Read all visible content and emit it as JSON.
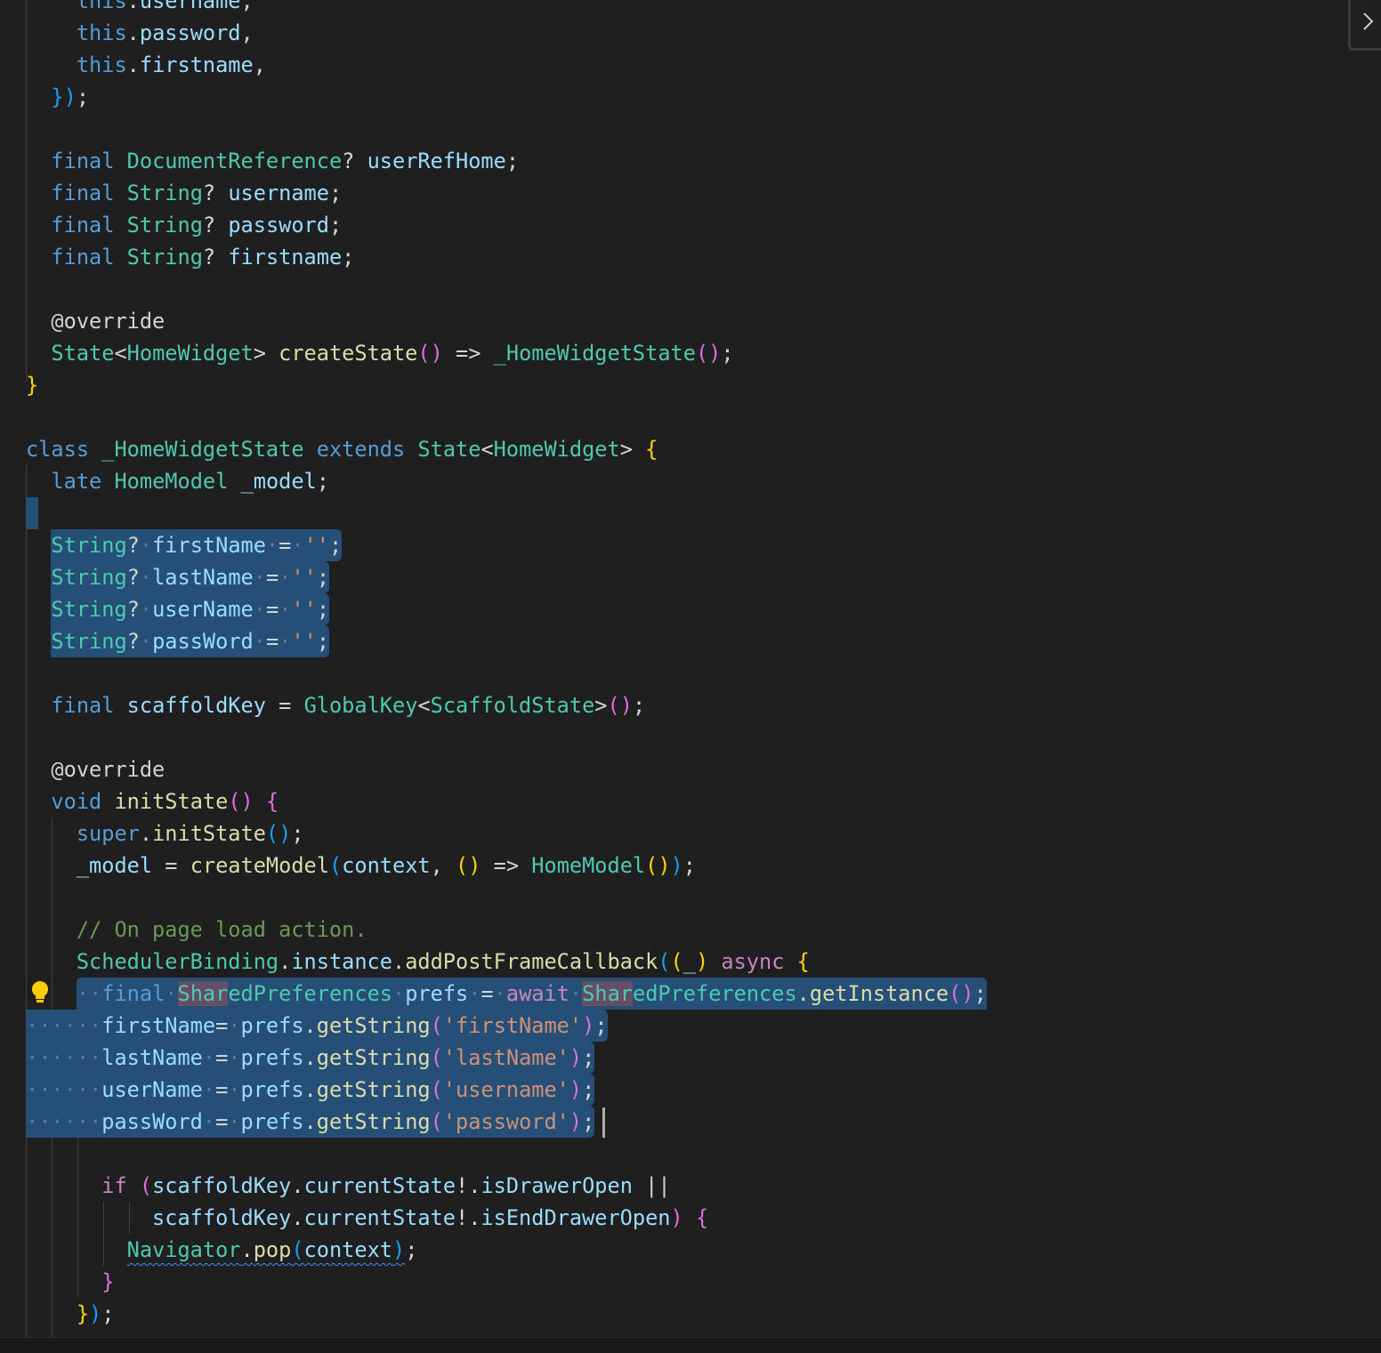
{
  "editor": {
    "language": "dart",
    "lines": [
      {
        "indent": 4,
        "t": [
          [
            "kw",
            "this"
          ],
          [
            "p",
            "."
          ],
          [
            "v",
            "username"
          ],
          [
            "p",
            ","
          ]
        ]
      },
      {
        "indent": 4,
        "t": [
          [
            "kw",
            "this"
          ],
          [
            "p",
            "."
          ],
          [
            "v",
            "password"
          ],
          [
            "p",
            ","
          ]
        ]
      },
      {
        "indent": 4,
        "t": [
          [
            "kw",
            "this"
          ],
          [
            "p",
            "."
          ],
          [
            "v",
            "firstname"
          ],
          [
            "p",
            ","
          ]
        ]
      },
      {
        "indent": 2,
        "t": [
          [
            "b3",
            "}"
          ],
          [
            "b3",
            ")"
          ],
          [
            "p",
            ";"
          ]
        ]
      },
      {
        "indent": 0,
        "t": []
      },
      {
        "indent": 2,
        "t": [
          [
            "kw",
            "final"
          ],
          [
            "p",
            " "
          ],
          [
            "ty",
            "DocumentReference"
          ],
          [
            "p",
            "? "
          ],
          [
            "v",
            "userRefHome"
          ],
          [
            "p",
            ";"
          ]
        ]
      },
      {
        "indent": 2,
        "t": [
          [
            "kw",
            "final"
          ],
          [
            "p",
            " "
          ],
          [
            "ty",
            "String"
          ],
          [
            "p",
            "? "
          ],
          [
            "v",
            "username"
          ],
          [
            "p",
            ";"
          ]
        ]
      },
      {
        "indent": 2,
        "t": [
          [
            "kw",
            "final"
          ],
          [
            "p",
            " "
          ],
          [
            "ty",
            "String"
          ],
          [
            "p",
            "? "
          ],
          [
            "v",
            "password"
          ],
          [
            "p",
            ";"
          ]
        ]
      },
      {
        "indent": 2,
        "t": [
          [
            "kw",
            "final"
          ],
          [
            "p",
            " "
          ],
          [
            "ty",
            "String"
          ],
          [
            "p",
            "? "
          ],
          [
            "v",
            "firstname"
          ],
          [
            "p",
            ";"
          ]
        ]
      },
      {
        "indent": 0,
        "t": []
      },
      {
        "indent": 2,
        "t": [
          [
            "an",
            "@override"
          ]
        ]
      },
      {
        "indent": 2,
        "t": [
          [
            "ty",
            "State"
          ],
          [
            "p",
            "<"
          ],
          [
            "ty",
            "HomeWidget"
          ],
          [
            "p",
            "> "
          ],
          [
            "fn",
            "createState"
          ],
          [
            "b2",
            "()"
          ],
          [
            "p",
            " => "
          ],
          [
            "ty",
            "_HomeWidgetState"
          ],
          [
            "b2",
            "()"
          ],
          [
            "p",
            ";"
          ]
        ]
      },
      {
        "indent": 0,
        "t": [
          [
            "b1",
            "}"
          ]
        ]
      },
      {
        "indent": 0,
        "t": []
      },
      {
        "indent": 0,
        "t": [
          [
            "kw",
            "class"
          ],
          [
            "p",
            " "
          ],
          [
            "ty",
            "_HomeWidgetState"
          ],
          [
            "p",
            " "
          ],
          [
            "kw",
            "extends"
          ],
          [
            "p",
            " "
          ],
          [
            "ty",
            "State"
          ],
          [
            "p",
            "<"
          ],
          [
            "ty",
            "HomeWidget"
          ],
          [
            "p",
            "> "
          ],
          [
            "b1",
            "{"
          ]
        ]
      },
      {
        "indent": 2,
        "t": [
          [
            "kw",
            "late"
          ],
          [
            "p",
            " "
          ],
          [
            "ty",
            "HomeModel"
          ],
          [
            "p",
            " "
          ],
          [
            "v",
            "_model"
          ],
          [
            "p",
            ";"
          ]
        ]
      },
      {
        "indent": 0,
        "t": [],
        "selected": "empty"
      },
      {
        "indent": 2,
        "t": [
          [
            "ty",
            "String"
          ],
          [
            "p",
            "?"
          ],
          [
            "ws",
            "·"
          ],
          [
            "v",
            "firstName"
          ],
          [
            "ws",
            "·"
          ],
          [
            "p",
            "="
          ],
          [
            "ws",
            "·"
          ],
          [
            "s",
            "''"
          ],
          [
            "p",
            ";"
          ]
        ],
        "selected": "full"
      },
      {
        "indent": 2,
        "t": [
          [
            "ty",
            "String"
          ],
          [
            "p",
            "?"
          ],
          [
            "ws",
            "·"
          ],
          [
            "v",
            "lastName"
          ],
          [
            "ws",
            "·"
          ],
          [
            "p",
            "="
          ],
          [
            "ws",
            "·"
          ],
          [
            "s",
            "''"
          ],
          [
            "p",
            ";"
          ]
        ],
        "selected": "full"
      },
      {
        "indent": 2,
        "t": [
          [
            "ty",
            "String"
          ],
          [
            "p",
            "?"
          ],
          [
            "ws",
            "·"
          ],
          [
            "v",
            "userName"
          ],
          [
            "ws",
            "·"
          ],
          [
            "p",
            "="
          ],
          [
            "ws",
            "·"
          ],
          [
            "s",
            "''"
          ],
          [
            "p",
            ";"
          ]
        ],
        "selected": "full"
      },
      {
        "indent": 2,
        "t": [
          [
            "ty",
            "String"
          ],
          [
            "p",
            "?"
          ],
          [
            "ws",
            "·"
          ],
          [
            "v",
            "passWord"
          ],
          [
            "ws",
            "·"
          ],
          [
            "p",
            "="
          ],
          [
            "ws",
            "·"
          ],
          [
            "s",
            "''"
          ],
          [
            "p",
            ";"
          ]
        ],
        "selected": "full"
      },
      {
        "indent": 0,
        "t": []
      },
      {
        "indent": 2,
        "t": [
          [
            "kw",
            "final"
          ],
          [
            "p",
            " "
          ],
          [
            "v",
            "scaffoldKey"
          ],
          [
            "p",
            " = "
          ],
          [
            "ty",
            "GlobalKey"
          ],
          [
            "p",
            "<"
          ],
          [
            "ty",
            "ScaffoldState"
          ],
          [
            "p",
            ">"
          ],
          [
            "b2",
            "()"
          ],
          [
            "p",
            ";"
          ]
        ]
      },
      {
        "indent": 0,
        "t": []
      },
      {
        "indent": 2,
        "t": [
          [
            "an",
            "@override"
          ]
        ]
      },
      {
        "indent": 2,
        "t": [
          [
            "kw",
            "void"
          ],
          [
            "p",
            " "
          ],
          [
            "fn",
            "initState"
          ],
          [
            "b2",
            "()"
          ],
          [
            "p",
            " "
          ],
          [
            "b2",
            "{"
          ]
        ]
      },
      {
        "indent": 4,
        "t": [
          [
            "kw",
            "super"
          ],
          [
            "p",
            "."
          ],
          [
            "fn",
            "initState"
          ],
          [
            "b3",
            "()"
          ],
          [
            "p",
            ";"
          ]
        ]
      },
      {
        "indent": 4,
        "t": [
          [
            "v",
            "_model"
          ],
          [
            "p",
            " = "
          ],
          [
            "fn",
            "createModel"
          ],
          [
            "b3",
            "("
          ],
          [
            "v",
            "context"
          ],
          [
            "p",
            ", "
          ],
          [
            "b1",
            "()"
          ],
          [
            "p",
            " => "
          ],
          [
            "ty",
            "HomeModel"
          ],
          [
            "b1",
            "()"
          ],
          [
            "b3",
            ")"
          ],
          [
            "p",
            ";"
          ]
        ]
      },
      {
        "indent": 0,
        "t": []
      },
      {
        "indent": 4,
        "t": [
          [
            "c",
            "// On page load action."
          ]
        ]
      },
      {
        "indent": 4,
        "t": [
          [
            "ty",
            "SchedulerBinding"
          ],
          [
            "p",
            "."
          ],
          [
            "v",
            "instance"
          ],
          [
            "p",
            "."
          ],
          [
            "fn",
            "addPostFrameCallback"
          ],
          [
            "b3",
            "("
          ],
          [
            "b1",
            "("
          ],
          [
            "v",
            "_"
          ],
          [
            "b1",
            ")"
          ],
          [
            "p",
            " "
          ],
          [
            "ct",
            "async"
          ],
          [
            "p",
            " "
          ],
          [
            "b1",
            "{"
          ]
        ]
      },
      {
        "indent": 4,
        "t": [
          [
            "ws",
            "··"
          ],
          [
            "kw",
            "final"
          ],
          [
            "ws",
            "·"
          ],
          [
            "ty hl",
            "Shar"
          ],
          [
            "ty",
            "edPreferences"
          ],
          [
            "ws",
            "·"
          ],
          [
            "v",
            "prefs"
          ],
          [
            "ws",
            "·"
          ],
          [
            "p",
            "="
          ],
          [
            "ws",
            "·"
          ],
          [
            "ct",
            "await"
          ],
          [
            "ws",
            "·"
          ],
          [
            "ty hl",
            "Shar"
          ],
          [
            "ty",
            "edPreferences"
          ],
          [
            "p",
            "."
          ],
          [
            "fn",
            "getInstance"
          ],
          [
            "b2",
            "()"
          ],
          [
            "p",
            ";"
          ]
        ],
        "selected": "partial"
      },
      {
        "indent": 0,
        "t": [
          [
            "ws",
            "······"
          ],
          [
            "v",
            "firstName"
          ],
          [
            "p",
            "="
          ],
          [
            "ws",
            "·"
          ],
          [
            "v",
            "prefs"
          ],
          [
            "p",
            "."
          ],
          [
            "fn",
            "getString"
          ],
          [
            "b2",
            "("
          ],
          [
            "s",
            "'firstName'"
          ],
          [
            "b2",
            ")"
          ],
          [
            "p",
            ";"
          ]
        ],
        "selected": "full"
      },
      {
        "indent": 0,
        "t": [
          [
            "ws",
            "······"
          ],
          [
            "v",
            "lastName"
          ],
          [
            "ws",
            "·"
          ],
          [
            "p",
            "="
          ],
          [
            "ws",
            "·"
          ],
          [
            "v",
            "prefs"
          ],
          [
            "p",
            "."
          ],
          [
            "fn",
            "getString"
          ],
          [
            "b2",
            "("
          ],
          [
            "s",
            "'lastName'"
          ],
          [
            "b2",
            ")"
          ],
          [
            "p",
            ";"
          ]
        ],
        "selected": "full"
      },
      {
        "indent": 0,
        "t": [
          [
            "ws",
            "······"
          ],
          [
            "v",
            "userName"
          ],
          [
            "ws",
            "·"
          ],
          [
            "p",
            "="
          ],
          [
            "ws",
            "·"
          ],
          [
            "v",
            "prefs"
          ],
          [
            "p",
            "."
          ],
          [
            "fn",
            "getString"
          ],
          [
            "b2",
            "("
          ],
          [
            "s",
            "'username'"
          ],
          [
            "b2",
            ")"
          ],
          [
            "p",
            ";"
          ]
        ],
        "selected": "full"
      },
      {
        "indent": 0,
        "t": [
          [
            "ws",
            "······"
          ],
          [
            "v",
            "passWord"
          ],
          [
            "ws",
            "·"
          ],
          [
            "p",
            "="
          ],
          [
            "ws",
            "·"
          ],
          [
            "v",
            "prefs"
          ],
          [
            "p",
            "."
          ],
          [
            "fn",
            "getString"
          ],
          [
            "b2",
            "("
          ],
          [
            "s",
            "'password'"
          ],
          [
            "b2",
            ")"
          ],
          [
            "p",
            ";"
          ]
        ],
        "selected": "full"
      },
      {
        "indent": 0,
        "t": []
      },
      {
        "indent": 6,
        "t": [
          [
            "ct",
            "if"
          ],
          [
            "p",
            " "
          ],
          [
            "b2",
            "("
          ],
          [
            "v",
            "scaffoldKey"
          ],
          [
            "p",
            "."
          ],
          [
            "v",
            "currentState"
          ],
          [
            "p",
            "!."
          ],
          [
            "v",
            "isDrawerOpen"
          ],
          [
            "p",
            " ||"
          ]
        ]
      },
      {
        "indent": 10,
        "t": [
          [
            "v",
            "scaffoldKey"
          ],
          [
            "p",
            "."
          ],
          [
            "v",
            "currentState"
          ],
          [
            "p",
            "!."
          ],
          [
            "v",
            "isEndDrawerOpen"
          ],
          [
            "b2",
            ")"
          ],
          [
            "p",
            " "
          ],
          [
            "b2",
            "{"
          ]
        ]
      },
      {
        "indent": 8,
        "t": [
          [
            "ty sq",
            "Navigator"
          ],
          [
            "p sq",
            "."
          ],
          [
            "fn sq",
            "pop"
          ],
          [
            "b3 sq",
            "("
          ],
          [
            "v sq",
            "context"
          ],
          [
            "b3 sq",
            ")"
          ],
          [
            "p",
            ";"
          ]
        ]
      },
      {
        "indent": 6,
        "t": [
          [
            "b2",
            "}"
          ]
        ]
      },
      {
        "indent": 4,
        "t": [
          [
            "b1",
            "}"
          ],
          [
            "b3",
            ")"
          ],
          [
            "p",
            ";"
          ]
        ]
      }
    ]
  },
  "icons": {
    "lightbulb": "lightbulb-icon",
    "panel_toggle": "chevron-right-icon"
  },
  "colors": {
    "background": "#1f1f1f",
    "selection": "#264f78",
    "lightbulb": "#ffcc00"
  }
}
